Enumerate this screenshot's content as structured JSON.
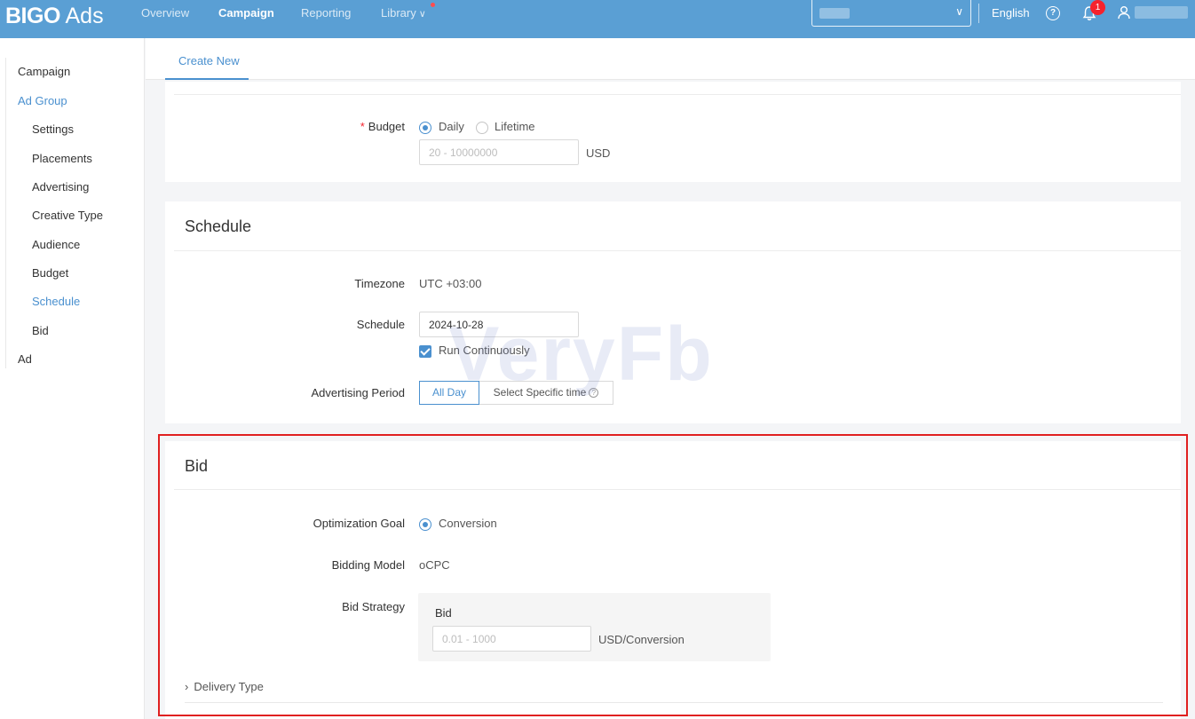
{
  "header": {
    "logo_bold": "BIGO",
    "logo_light": "Ads",
    "nav": [
      {
        "label": "Overview",
        "active": false
      },
      {
        "label": "Campaign",
        "active": true
      },
      {
        "label": "Reporting",
        "active": false
      },
      {
        "label": "Library",
        "active": false
      }
    ],
    "language": "English",
    "notification_count": "1"
  },
  "sidebar": {
    "items": [
      {
        "label": "Campaign",
        "level": 1,
        "active": false
      },
      {
        "label": "Ad Group",
        "level": 1,
        "active": true
      },
      {
        "label": "Settings",
        "level": 2,
        "active": false
      },
      {
        "label": "Placements",
        "level": 2,
        "active": false
      },
      {
        "label": "Advertising",
        "level": 2,
        "active": false
      },
      {
        "label": "Creative Type",
        "level": 2,
        "active": false
      },
      {
        "label": "Audience",
        "level": 2,
        "active": false
      },
      {
        "label": "Budget",
        "level": 2,
        "active": false
      },
      {
        "label": "Schedule",
        "level": 2,
        "active": true
      },
      {
        "label": "Bid",
        "level": 2,
        "active": false
      },
      {
        "label": "Ad",
        "level": 1,
        "active": false
      }
    ]
  },
  "tabs": {
    "create_new": "Create New"
  },
  "budget": {
    "label": "Budget",
    "options": [
      "Daily",
      "Lifetime"
    ],
    "selected": "Daily",
    "placeholder": "20 - 10000000",
    "currency": "USD"
  },
  "schedule": {
    "title": "Schedule",
    "timezone_label": "Timezone",
    "timezone_value": "UTC +03:00",
    "schedule_label": "Schedule",
    "schedule_date": "2024-10-28",
    "run_continuously": "Run Continuously",
    "period_label": "Advertising Period",
    "period_options": [
      "All Day",
      "Select Specific time"
    ],
    "period_selected": "All Day"
  },
  "bid": {
    "title": "Bid",
    "goal_label": "Optimization Goal",
    "goal_value": "Conversion",
    "model_label": "Bidding Model",
    "model_value": "oCPC",
    "strategy_label": "Bid Strategy",
    "bid_label": "Bid",
    "bid_placeholder": "0.01 - 1000",
    "bid_unit": "USD/Conversion",
    "delivery_type": "Delivery Type"
  },
  "watermark": "VeryFb",
  "colors": {
    "topbar": "#5a9fd4",
    "accent": "#4a90cf",
    "highlight": "#e02020"
  }
}
